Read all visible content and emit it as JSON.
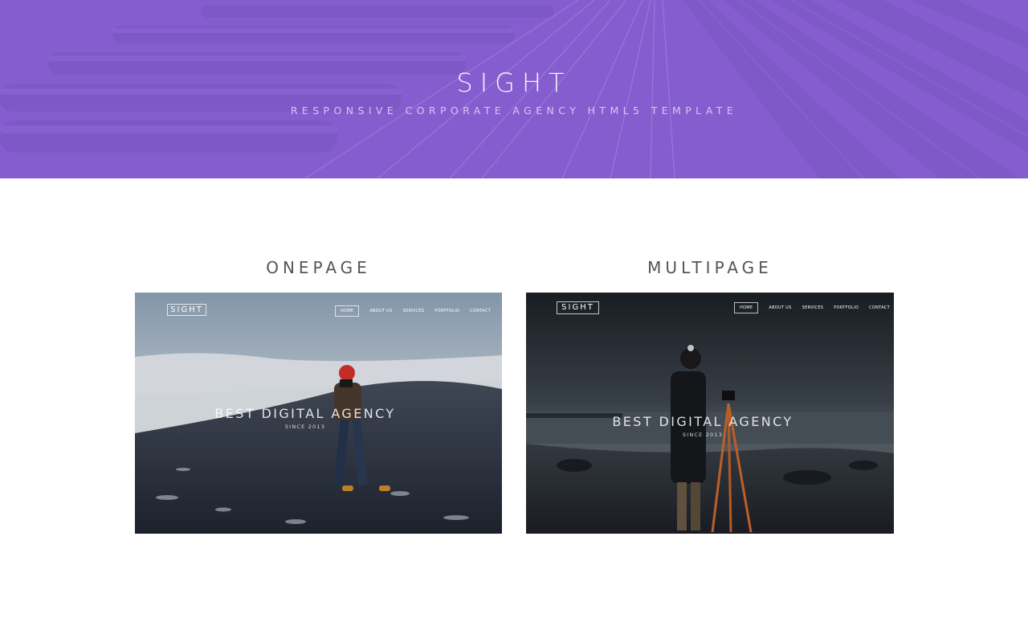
{
  "hero": {
    "title": "SIGHT",
    "subtitle": "RESPONSIVE CORPORATE AGENCY HTML5 TEMPLATE"
  },
  "demos": [
    {
      "title": "ONEPAGE",
      "preview": {
        "logo": "SIGHT",
        "nav": [
          "HOME",
          "ABOUT US",
          "SERVICES",
          "PORTFOLIO",
          "CONTACT"
        ],
        "headline": "BEST DIGITAL AGENCY",
        "since": "SINCE 2013"
      }
    },
    {
      "title": "MULTIPAGE",
      "preview": {
        "logo": "SIGHT",
        "nav": [
          "HOME",
          "ABOUT US",
          "SERVICES",
          "PORTFOLIO",
          "CONTACT"
        ],
        "headline": "BEST DIGITAL AGENCY",
        "since": "SINCE 2013"
      }
    }
  ],
  "colors": {
    "hero_overlay": "#8a5fd3",
    "heading_text": "#555555",
    "background": "#ffffff"
  }
}
